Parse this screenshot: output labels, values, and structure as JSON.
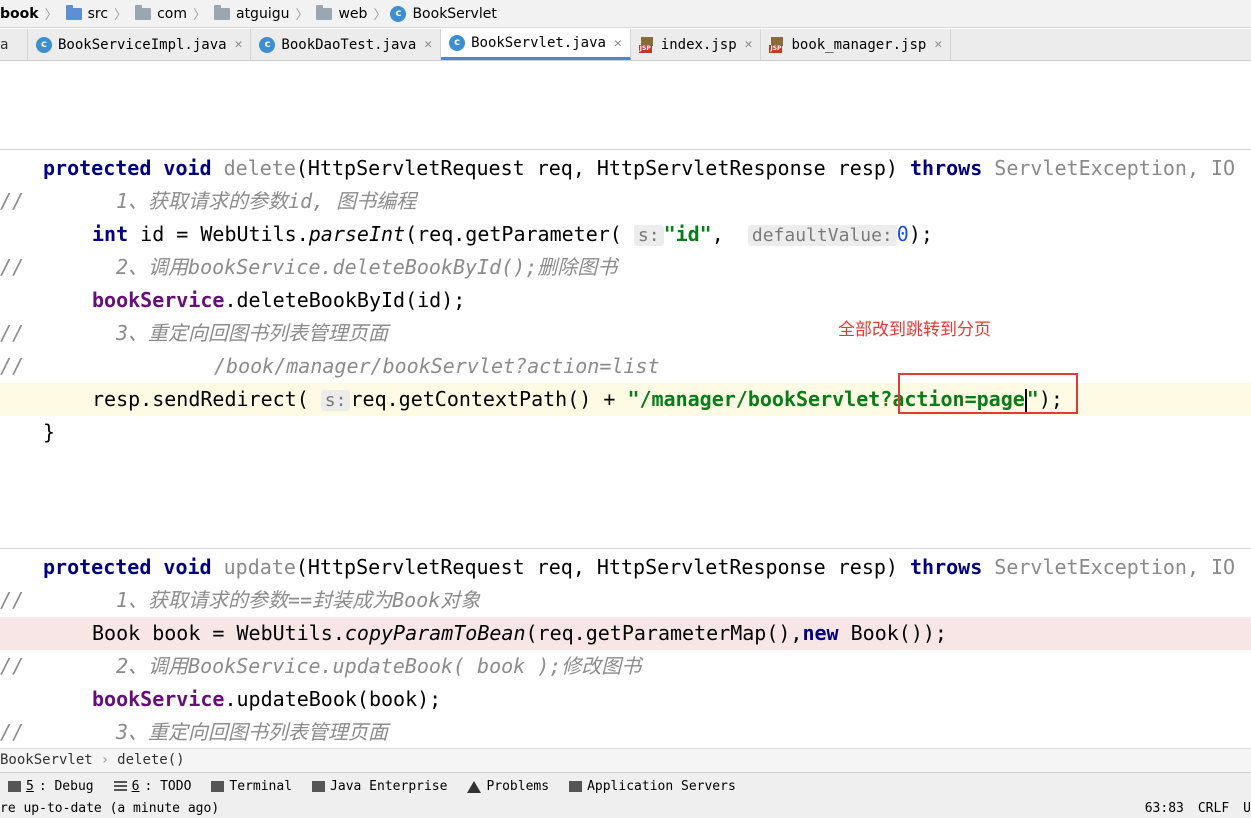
{
  "breadcrumb": {
    "items": [
      "book",
      "src",
      "com",
      "atguigu",
      "web",
      "BookServlet"
    ]
  },
  "tabs": [
    {
      "label": "BookServiceImpl.java",
      "icon": "class-icon",
      "active": false
    },
    {
      "label": "BookDaoTest.java",
      "icon": "class-icon",
      "active": false
    },
    {
      "label": "BookServlet.java",
      "icon": "class-icon",
      "active": true
    },
    {
      "label": "index.jsp",
      "icon": "jsp-icon",
      "active": false
    },
    {
      "label": "book_manager.jsp",
      "icon": "jsp-icon",
      "active": false
    }
  ],
  "code": {
    "gutter_comment": "//",
    "delete": {
      "kw1": "protected",
      "kw2": "void",
      "name": "delete",
      "params": "(HttpServletRequest req, HttpServletResponse resp) ",
      "throws": "throws",
      "exception": "ServletException, IO",
      "c1": "1、获取请求的参数id, 图书编程",
      "l2_type": "int",
      "l2_a": " id = WebUtils.",
      "l2_method": "parseInt",
      "l2_b": "(req.getParameter(",
      "hint_s": "s:",
      "l2_str": "\"id\"",
      "l2_c": ", ",
      "hint_default": "defaultValue:",
      "l2_num": "0",
      "l2_end": ");",
      "c2": "2、调用bookService.deleteBookById();删除图书",
      "l3_field": "bookService",
      "l3_rest": ".deleteBookById(id);",
      "c3": "3、重定向回图书列表管理页面",
      "c4": "/book/manager/bookServlet?action=list",
      "l4_a": "resp.sendRedirect(",
      "l4_b": "req.getContextPath() + ",
      "l4_str1": "\"/manager/bookServlet?action=page",
      "l4_str2": "\"",
      "l4_end": ");",
      "close": "}"
    },
    "update": {
      "kw1": "protected",
      "kw2": "void",
      "name": "update",
      "params": "(HttpServletRequest req, HttpServletResponse resp) ",
      "throws": "throws",
      "exception": "ServletException, IO",
      "c1": "1、获取请求的参数==封装成为Book对象",
      "l2_a": "Book book = WebUtils.",
      "l2_method": "copyParamToBean",
      "l2_b": "(req.getParameterMap(),",
      "l2_new": "new",
      "l2_end": " Book());",
      "c2": "2、调用BookService.updateBook( book );修改图书",
      "l3_field": "bookService",
      "l3_rest": ".updateBook(book);",
      "c3": "3、重定向回图书列表管理页面"
    }
  },
  "annotation": "全部改到跳转到分页",
  "method_breadcrumb": {
    "class": "BookServlet",
    "method": "delete()"
  },
  "tool_windows": [
    {
      "num": "5",
      "label": ": Debug",
      "icon": "debug-icon"
    },
    {
      "num": "6",
      "label": ": TODO",
      "icon": "todo-icon"
    },
    {
      "num": "",
      "label": "Terminal",
      "icon": "terminal-icon"
    },
    {
      "num": "",
      "label": "Java Enterprise",
      "icon": "java-enterprise-icon"
    },
    {
      "num": "",
      "label": "Problems",
      "icon": "warning-icon"
    },
    {
      "num": "",
      "label": "Application Servers",
      "icon": "server-icon"
    }
  ],
  "status": {
    "message": "re up-to-date (a minute ago)",
    "position": "63:83",
    "line_ending": "CRLF",
    "encoding": "U"
  },
  "colors": {
    "keyword": "#000080",
    "string": "#067d17",
    "field": "#660e7a",
    "annotation_red": "#e53935",
    "active_tab": "#4a88c7"
  }
}
